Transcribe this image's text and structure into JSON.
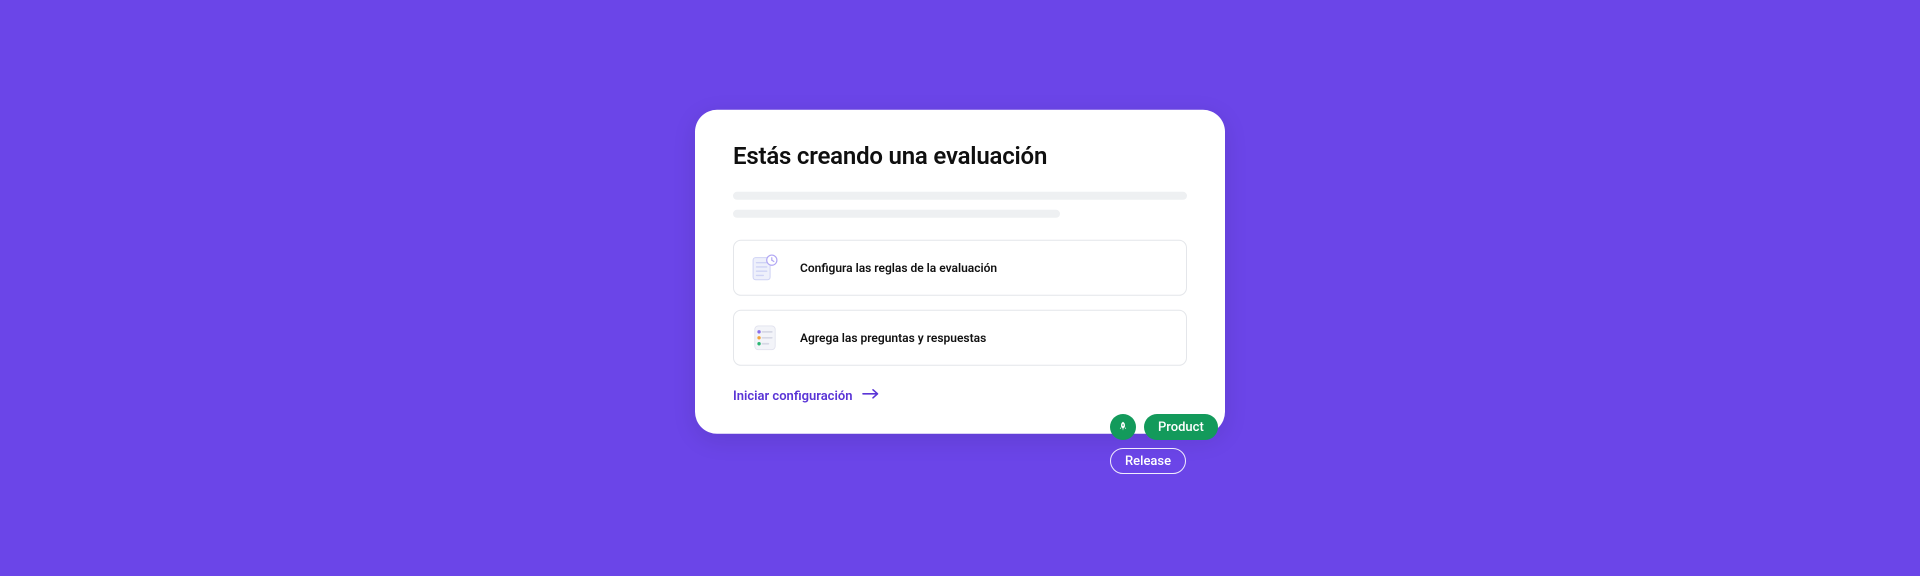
{
  "card": {
    "title": "Estás creando una evaluación",
    "steps": [
      {
        "label": "Configura las reglas de la evaluación"
      },
      {
        "label": "Agrega las preguntas y respuestas"
      }
    ],
    "cta": "Iniciar configuración"
  },
  "badges": {
    "product": "Product",
    "release": "Release"
  }
}
